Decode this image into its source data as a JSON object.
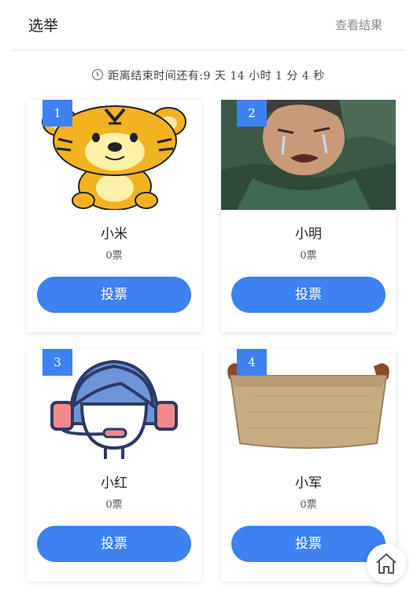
{
  "header": {
    "title": "选举",
    "results_link": "查看结果"
  },
  "countdown": {
    "text": "距离结束时间还有:9 天 14 小时 1 分 4 秒",
    "icon": "clock-icon"
  },
  "candidates": [
    {
      "number": "1",
      "name": "小米",
      "votes": "0票",
      "vote_label": "投票",
      "image": "tiger-cartoon"
    },
    {
      "number": "2",
      "name": "小明",
      "votes": "0票",
      "vote_label": "投票",
      "image": "crying-man"
    },
    {
      "number": "3",
      "name": "小红",
      "votes": "0票",
      "vote_label": "投票",
      "image": "headset-agent-icon"
    },
    {
      "number": "4",
      "name": "小军",
      "votes": "0票",
      "vote_label": "投票",
      "image": "linen-basket"
    }
  ],
  "colors": {
    "accent": "#3d82f0"
  },
  "fab": {
    "icon": "home-icon"
  }
}
